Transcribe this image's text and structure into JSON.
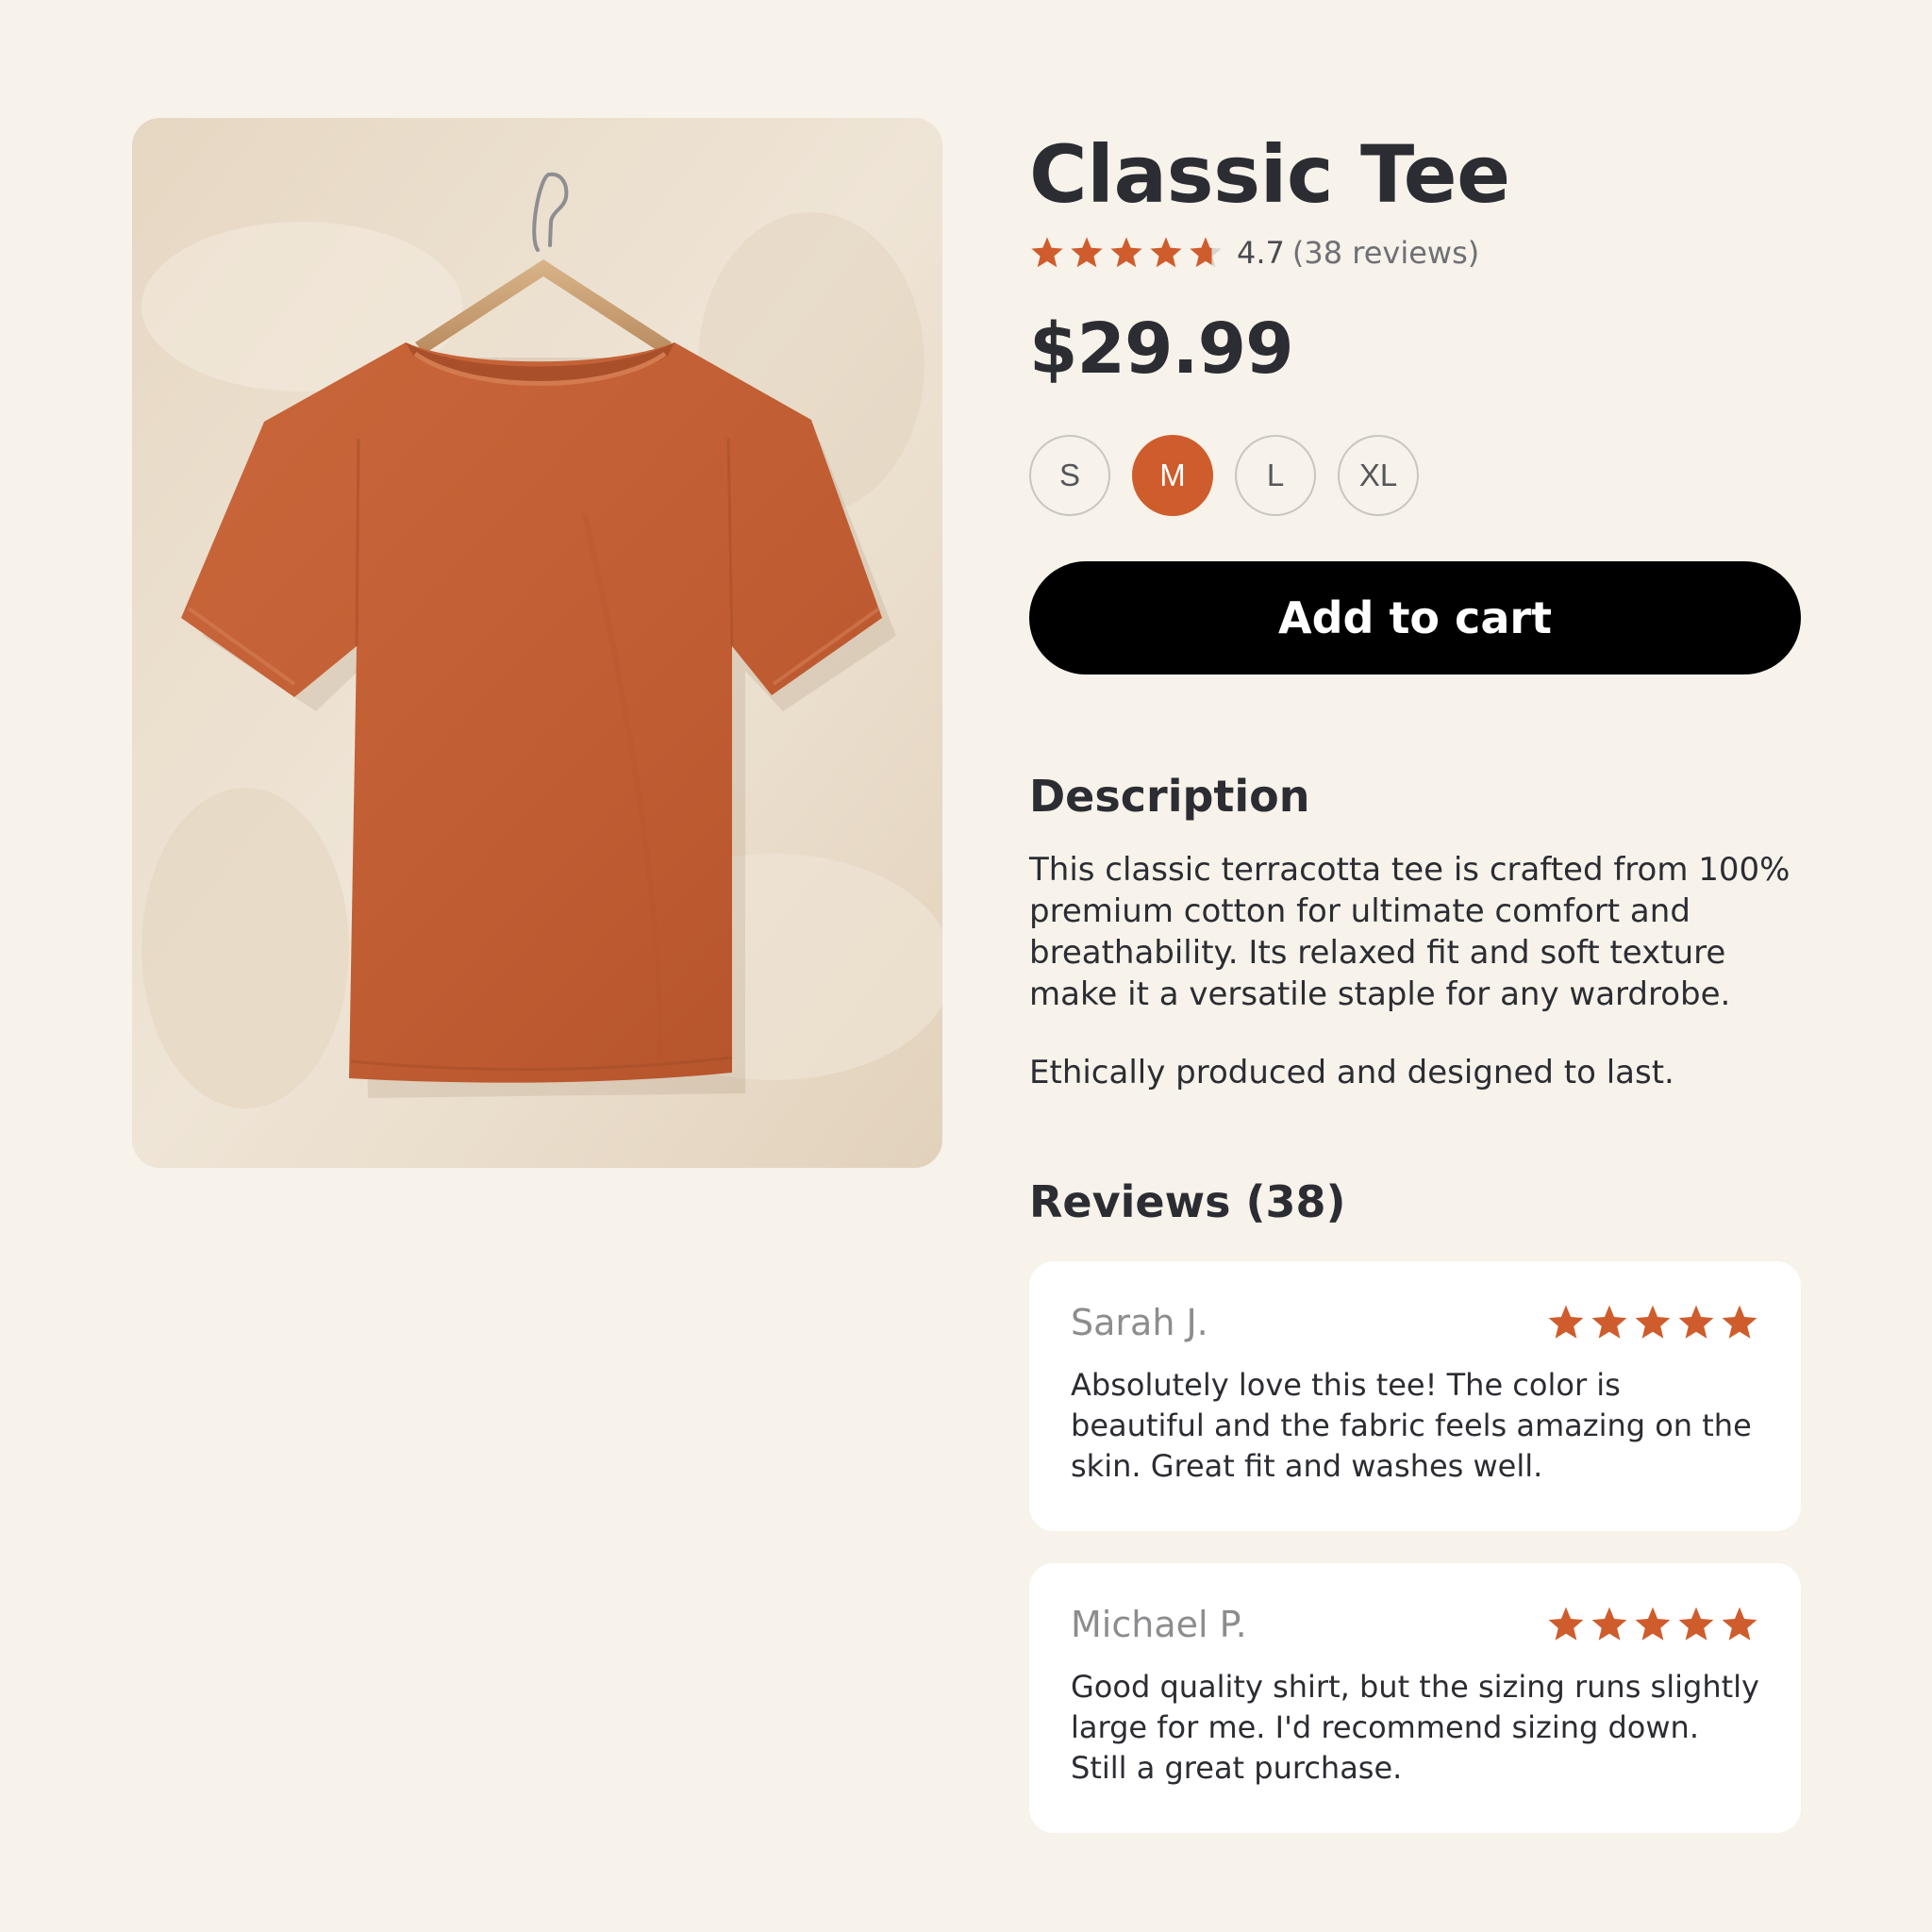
{
  "product": {
    "title": "Classic Tee",
    "image_icon": "tshirt-on-hanger-photo",
    "rating_value": "4.7",
    "rating_count": "(38 reviews)",
    "rating_stars": 4.7,
    "price": "$29.99",
    "sizes": [
      "S",
      "M",
      "L",
      "XL"
    ],
    "selected_size": "M",
    "add_to_cart_label": "Add to cart"
  },
  "description": {
    "heading": "Description",
    "text": "This classic terracotta tee is crafted from 100% premium cotton for ultimate comfort and breathability. Its relaxed fit and soft texture make it a versatile staple for any wardrobe.",
    "note": "Ethically produced and designed to last."
  },
  "reviews": {
    "heading": "Reviews (38)",
    "items": [
      {
        "name": "Sarah J.",
        "stars": 5,
        "text": "Absolutely love this tee! The color is beautiful and the fabric feels amazing on the skin. Great fit and washes well."
      },
      {
        "name": "Michael P.",
        "stars": 5,
        "text": "Good quality shirt, but the sizing runs slightly large for me. I'd recommend sizing down. Still a great purchase."
      }
    ]
  },
  "colors": {
    "accent": "#cf5c2c",
    "background": "#f7f2ea",
    "button": "#000000",
    "text": "#2b2d33"
  }
}
